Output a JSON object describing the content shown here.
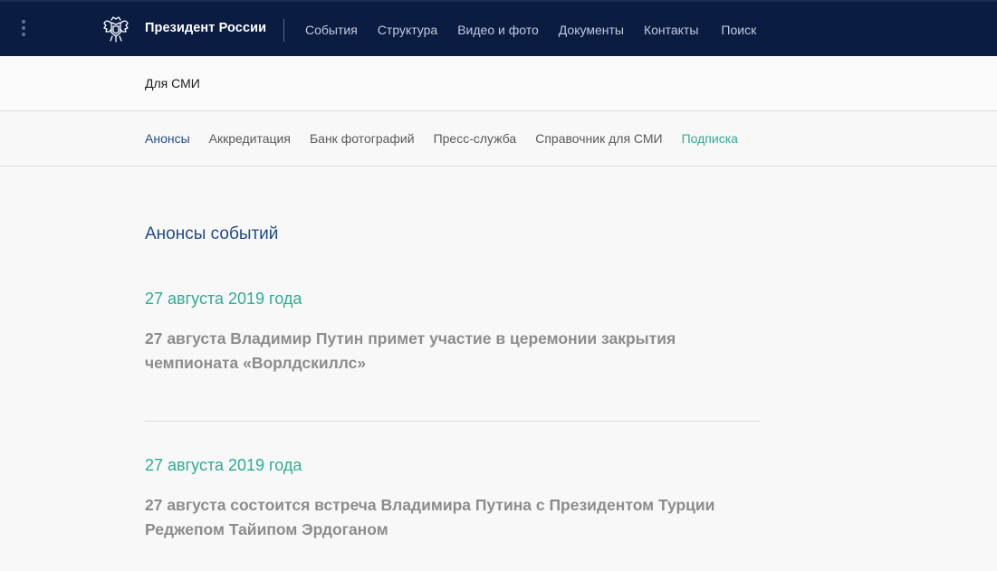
{
  "header": {
    "site_title": "Президент России",
    "nav": [
      "События",
      "Структура",
      "Видео и фото",
      "Документы",
      "Контакты",
      "Поиск"
    ],
    "background_color": "#0b1c43",
    "menu_icon": "menu-dots-icon",
    "logo_icon": "double-headed-eagle-emblem"
  },
  "section": {
    "title": "Для СМИ"
  },
  "subnav": {
    "items": [
      "Анонсы",
      "Аккредитация",
      "Банк фотографий",
      "Пресс-служба",
      "Справочник для СМИ",
      "Подписка"
    ],
    "active_index": 0,
    "accent_color": "#2eab92",
    "active_color": "#2a4b86"
  },
  "main": {
    "heading": "Анонсы событий",
    "announcements": [
      {
        "date": "27 августа 2019 года",
        "text": "27 августа Владимир Путин примет участие в церемонии закрытия чемпионата «Ворлдскиллс»"
      },
      {
        "date": "27 августа 2019 года",
        "text": "27 августа состоится встреча Владимира Путина с Президентом Турции Реджепом Тайипом Эрдоганом"
      }
    ]
  }
}
